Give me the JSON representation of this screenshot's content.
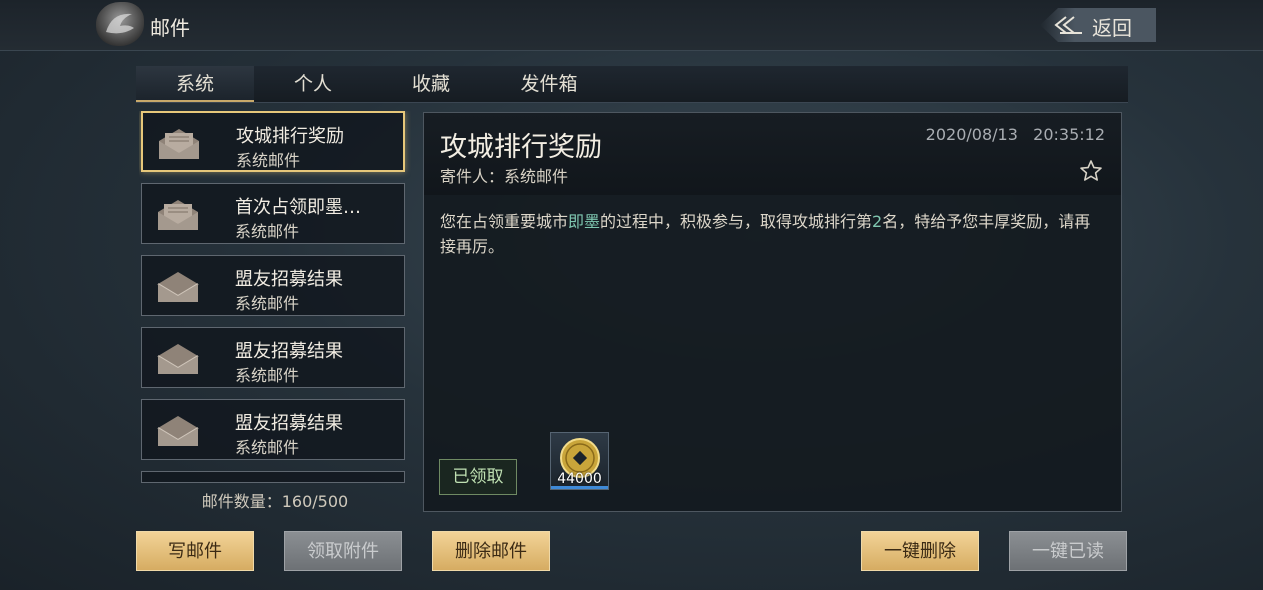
{
  "header": {
    "title": "邮件",
    "back_label": "返回"
  },
  "tabs": [
    {
      "label": "系统"
    },
    {
      "label": "个人"
    },
    {
      "label": "收藏"
    },
    {
      "label": "发件箱"
    }
  ],
  "mail_list": [
    {
      "subject": "攻城排行奖励",
      "sender": "系统邮件",
      "state": "unread"
    },
    {
      "subject": "首次占领即墨…",
      "sender": "系统邮件",
      "state": "unread"
    },
    {
      "subject": "盟友招募结果",
      "sender": "系统邮件",
      "state": "read"
    },
    {
      "subject": "盟友招募结果",
      "sender": "系统邮件",
      "state": "read"
    },
    {
      "subject": "盟友招募结果",
      "sender": "系统邮件",
      "state": "read"
    }
  ],
  "mail_count": "邮件数量：160/500",
  "detail": {
    "subject": "攻城排行奖励",
    "sender_line": "寄件人：系统邮件",
    "date": "2020/08/13",
    "time": "20:35:12",
    "body_part1": "您在占领重要城市",
    "body_city": "即墨",
    "body_part2": "的过程中，积极参与，取得攻城排行第",
    "body_rank": "2",
    "body_part3": "名，特给予您丰厚奖励，请再接再厉。",
    "claimed_label": "已领取",
    "reward_qty": "44000"
  },
  "buttons": {
    "write": "写邮件",
    "claim": "领取附件",
    "delete": "删除邮件",
    "delete_all": "一键删除",
    "read_all": "一键已读"
  },
  "colors": {
    "accent_gold": "#e6c77a",
    "highlight_green": "#7fc7b0"
  }
}
